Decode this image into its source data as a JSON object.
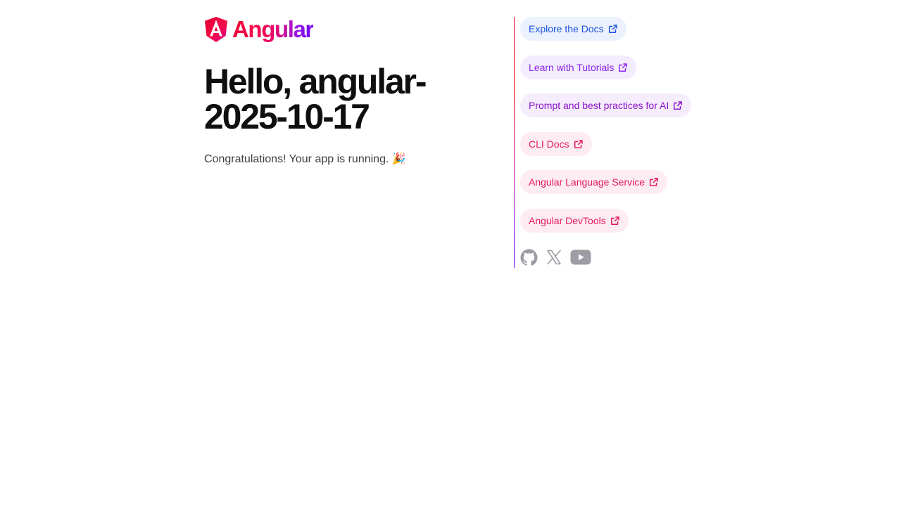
{
  "brand": {
    "name": "Angular"
  },
  "hero": {
    "title": "Hello, angular-2025-10-17",
    "subtitle": "Congratulations! Your app is running. 🎉"
  },
  "links": [
    {
      "label": "Explore the Docs",
      "icon": "external-link-icon",
      "color": "#1a51e0"
    },
    {
      "label": "Learn with Tutorials",
      "icon": "external-link-icon",
      "color": "#8d24e8"
    },
    {
      "label": "Prompt and best practices for AI",
      "icon": "external-link-icon",
      "color": "#8a11c9"
    },
    {
      "label": "CLI Docs",
      "icon": "external-link-icon",
      "color": "#e31960"
    },
    {
      "label": "Angular Language Service",
      "icon": "external-link-icon",
      "color": "#e31960"
    },
    {
      "label": "Angular DevTools",
      "icon": "external-link-icon",
      "color": "#e31960"
    }
  ],
  "social": [
    {
      "name": "github",
      "icon": "github-icon"
    },
    {
      "name": "x",
      "icon": "x-icon"
    },
    {
      "name": "youtube",
      "icon": "youtube-icon"
    }
  ],
  "colors": {
    "social_icon": "#9c9ca4",
    "text_primary": "#0f0f11",
    "text_secondary": "#3d3d44"
  }
}
